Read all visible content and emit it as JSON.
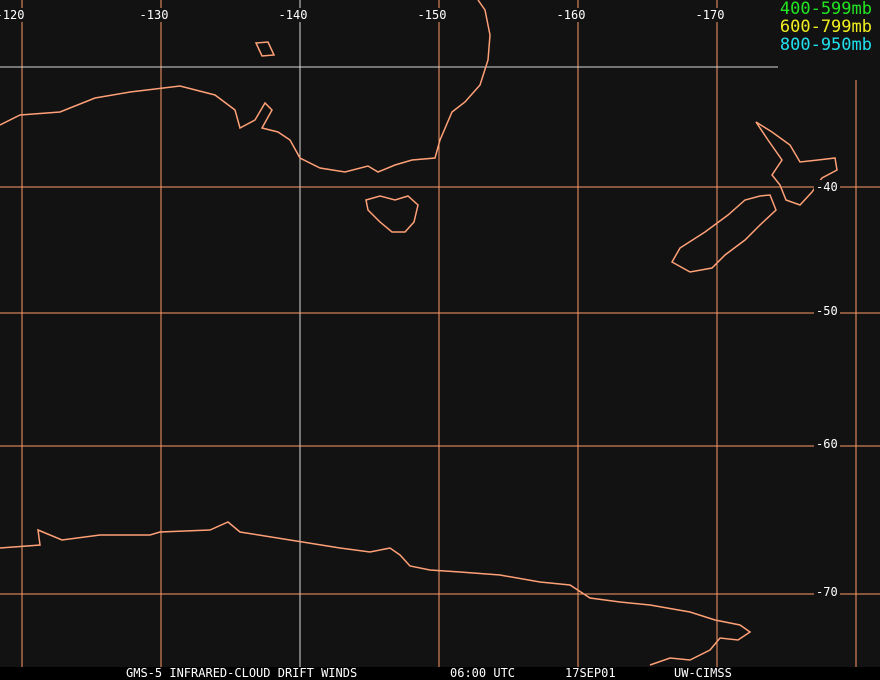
{
  "map": {
    "longitude_labels": [
      "-120",
      "-130",
      "-140",
      "-150",
      "-160",
      "-170"
    ],
    "latitude_labels": [
      "-40",
      "-50",
      "-60",
      "-70"
    ],
    "legend": [
      {
        "label": "400-599mb",
        "color": "#22e622"
      },
      {
        "label": "600-799mb",
        "color": "#f0f020"
      },
      {
        "label": "800-950mb",
        "color": "#20e0f0"
      }
    ],
    "coast_color": "#ffa077",
    "grid_color": "#ff9a66"
  },
  "footer": {
    "product": "GMS-5 INFRARED-CLOUD DRIFT WINDS",
    "time": "06:00 UTC",
    "date": "17SEP01",
    "source": "UW-CIMSS"
  }
}
